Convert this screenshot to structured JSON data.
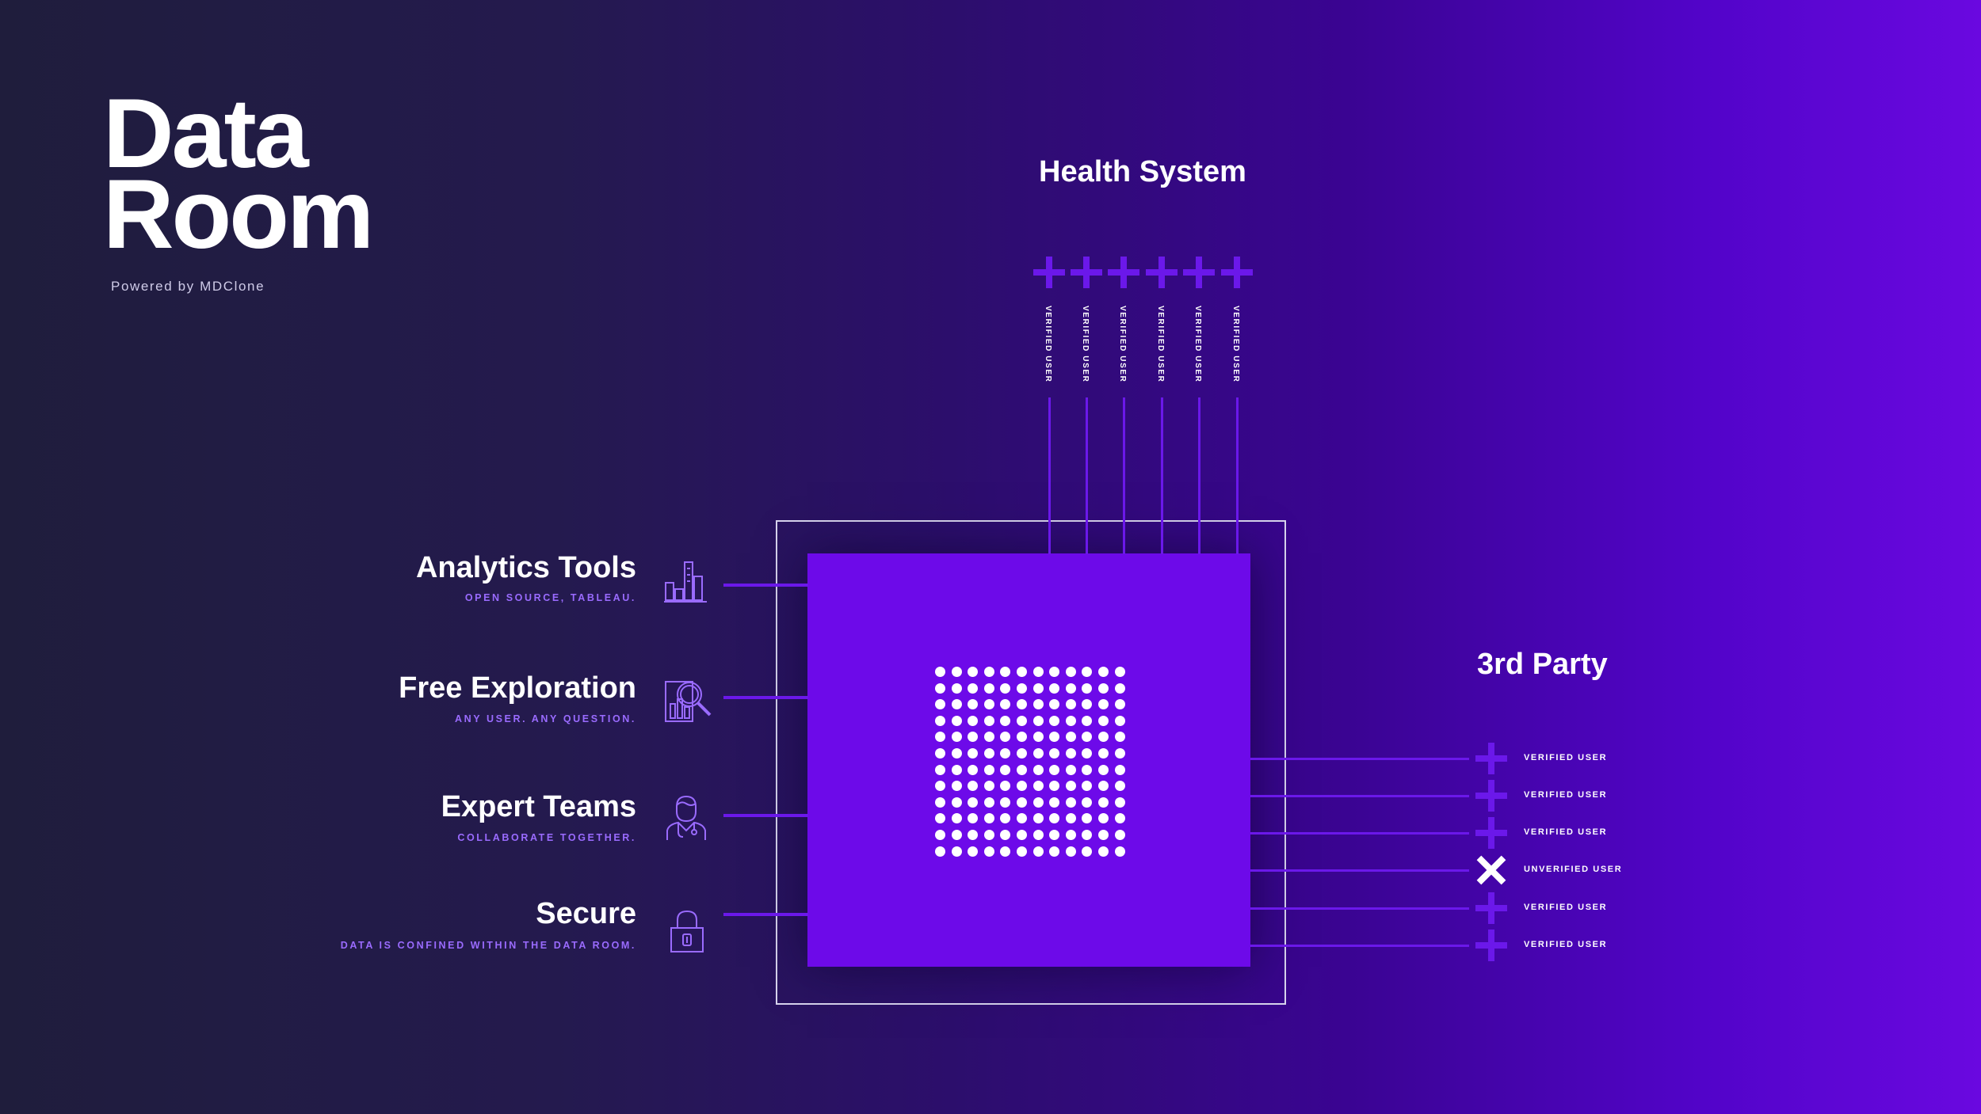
{
  "title": {
    "line1": "Data",
    "line2": "Room",
    "powered_by": "Powered by MDClone"
  },
  "health_system": {
    "title": "Health System",
    "users": [
      {
        "label": "VERIFIED USER",
        "status": "verified"
      },
      {
        "label": "VERIFIED USER",
        "status": "verified"
      },
      {
        "label": "VERIFIED USER",
        "status": "verified"
      },
      {
        "label": "VERIFIED USER",
        "status": "verified"
      },
      {
        "label": "VERIFIED USER",
        "status": "verified"
      },
      {
        "label": "VERIFIED USER",
        "status": "verified"
      }
    ]
  },
  "third_party": {
    "title": "3rd Party",
    "users": [
      {
        "label": "VERIFIED USER",
        "status": "verified"
      },
      {
        "label": "VERIFIED USER",
        "status": "verified"
      },
      {
        "label": "VERIFIED USER",
        "status": "verified"
      },
      {
        "label": "UNVERIFIED USER",
        "status": "unverified"
      },
      {
        "label": "VERIFIED USER",
        "status": "verified"
      },
      {
        "label": "VERIFIED USER",
        "status": "verified"
      }
    ]
  },
  "features": [
    {
      "title": "Analytics Tools",
      "subtitle": "OPEN SOURCE, TABLEAU.",
      "icon": "bar-chart-icon"
    },
    {
      "title": "Free Exploration",
      "subtitle": "ANY USER. ANY QUESTION.",
      "icon": "magnifier-chart-icon"
    },
    {
      "title": "Expert Teams",
      "subtitle": "COLLABORATE TOGETHER.",
      "icon": "doctor-icon"
    },
    {
      "title": "Secure",
      "subtitle": "DATA IS CONFINED WITHIN THE DATA ROOM.",
      "icon": "padlock-icon"
    }
  ],
  "colors": {
    "accent": "#6b18ea",
    "core": "#6d0ae9",
    "subtitle": "#9a6bff",
    "background_left": "#1f1d3c",
    "background_right": "#6a08e0"
  }
}
